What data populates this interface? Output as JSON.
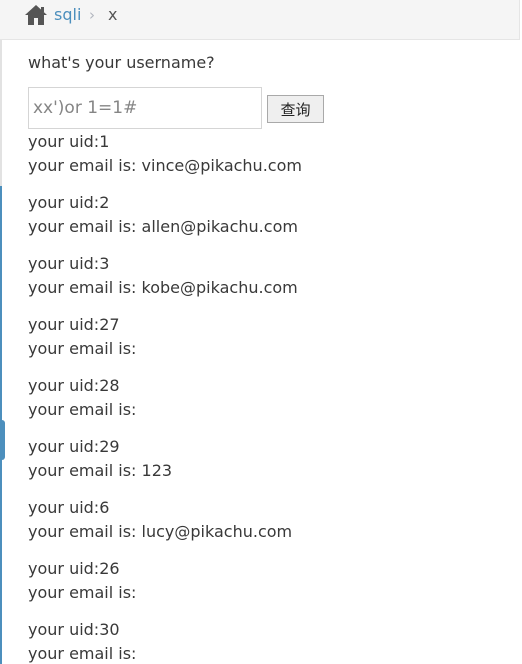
{
  "breadcrumb": {
    "home_icon": "home-icon",
    "link_label": "sqli",
    "separator": "›",
    "current_label": "x"
  },
  "form": {
    "question": "what's your username?",
    "input_value": "xx')or 1=1#",
    "submit_label": "查询"
  },
  "colors": {
    "link": "#4c8fbd",
    "text": "#393939",
    "breadcrumb_bg": "#f5f5f5"
  },
  "results": [
    {
      "uid": "your uid:1",
      "email": "your email is: vince@pikachu.com"
    },
    {
      "uid": "your uid:2",
      "email": "your email is: allen@pikachu.com"
    },
    {
      "uid": "your uid:3",
      "email": "your email is: kobe@pikachu.com"
    },
    {
      "uid": "your uid:27",
      "email": "your email is:"
    },
    {
      "uid": "your uid:28",
      "email": "your email is:"
    },
    {
      "uid": "your uid:29",
      "email": "your email is: 123"
    },
    {
      "uid": "your uid:6",
      "email": "your email is: lucy@pikachu.com"
    },
    {
      "uid": "your uid:26",
      "email": "your email is:"
    },
    {
      "uid": "your uid:30",
      "email": "your email is:"
    }
  ]
}
